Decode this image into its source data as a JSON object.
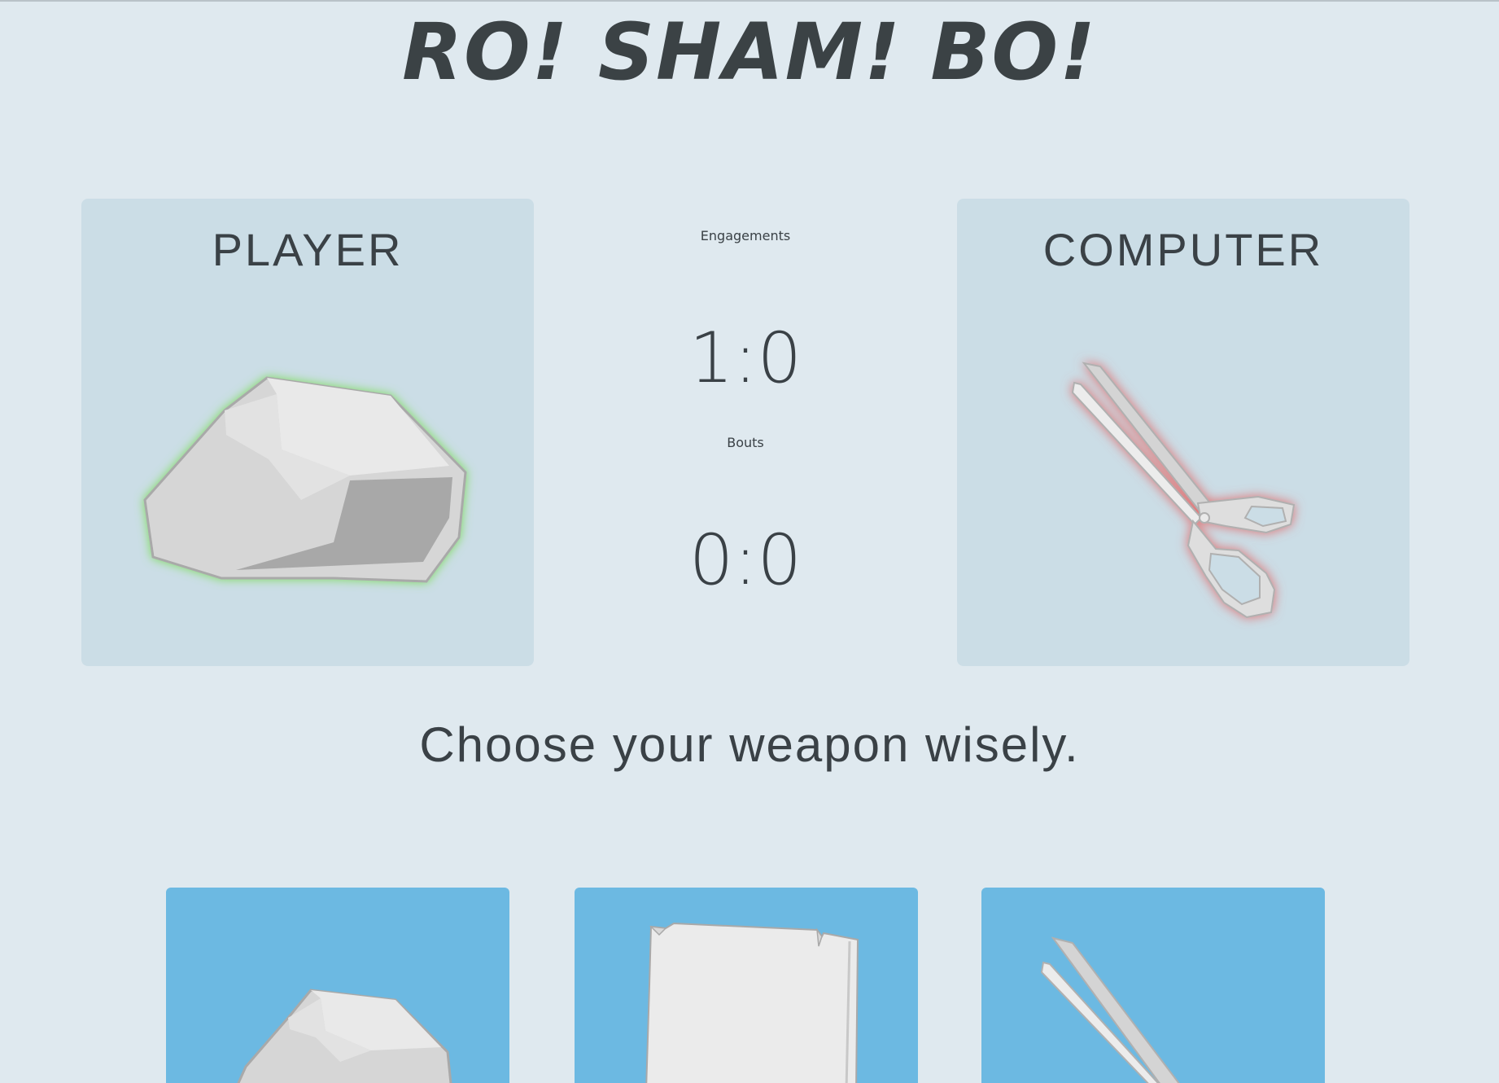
{
  "title": "RO! SHAM! BO!",
  "player": {
    "label": "PLAYER",
    "choice_icon": "rock-icon",
    "result_glow": "#7ddc5a"
  },
  "computer": {
    "label": "COMPUTER",
    "choice_icon": "scissors-icon",
    "result_glow": "#e07070"
  },
  "scoreboard": {
    "engagements_label": "Engagements",
    "engagements_score": "1:0",
    "bouts_label": "Bouts",
    "bouts_score": "0:0"
  },
  "instructions": "Choose your weapon wisely.",
  "weapons": [
    {
      "icon": "rock-icon"
    },
    {
      "icon": "paper-icon"
    },
    {
      "icon": "scissors-icon"
    }
  ],
  "colors": {
    "background": "#dfe9ef",
    "panel": "#cbdde6",
    "weapon_button": "#6cb9e2",
    "text": "#3a4146"
  }
}
